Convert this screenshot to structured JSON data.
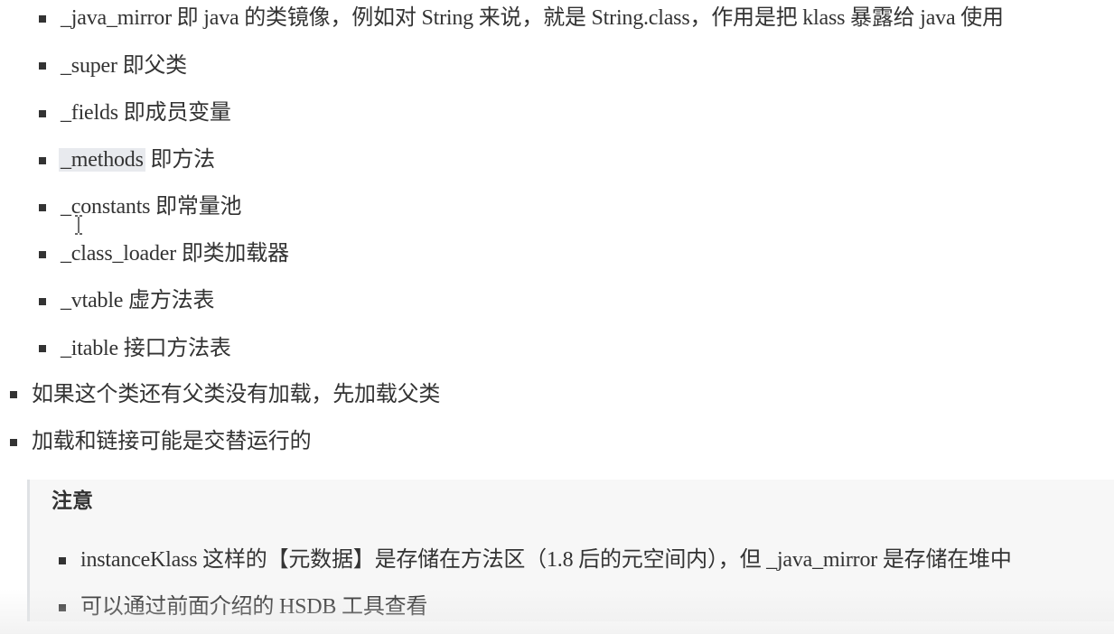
{
  "sub_list": [
    "_java_mirror 即 java 的类镜像，例如对 String 来说，就是 String.class，作用是把 klass 暴露给 java 使用",
    "_super 即父类",
    "_fields 即成员变量",
    "_methods",
    "_constants 即常量池",
    "_class_loader 即类加载器",
    "_vtable 虚方法表",
    "_itable 接口方法表"
  ],
  "methods_suffix": " 即方法",
  "main_list": [
    "如果这个类还有父类没有加载，先加载父类",
    "加载和链接可能是交替运行的"
  ],
  "note": {
    "title": "注意",
    "items": [
      "instanceKlass 这样的【元数据】是存储在方法区（1.8 后的元空间内），但 _java_mirror 是存储在堆中",
      "可以通过前面介绍的 HSDB 工具查看"
    ]
  },
  "icons": {
    "bullet": "square-bullet-icon",
    "cursor": "text-cursor-icon"
  }
}
